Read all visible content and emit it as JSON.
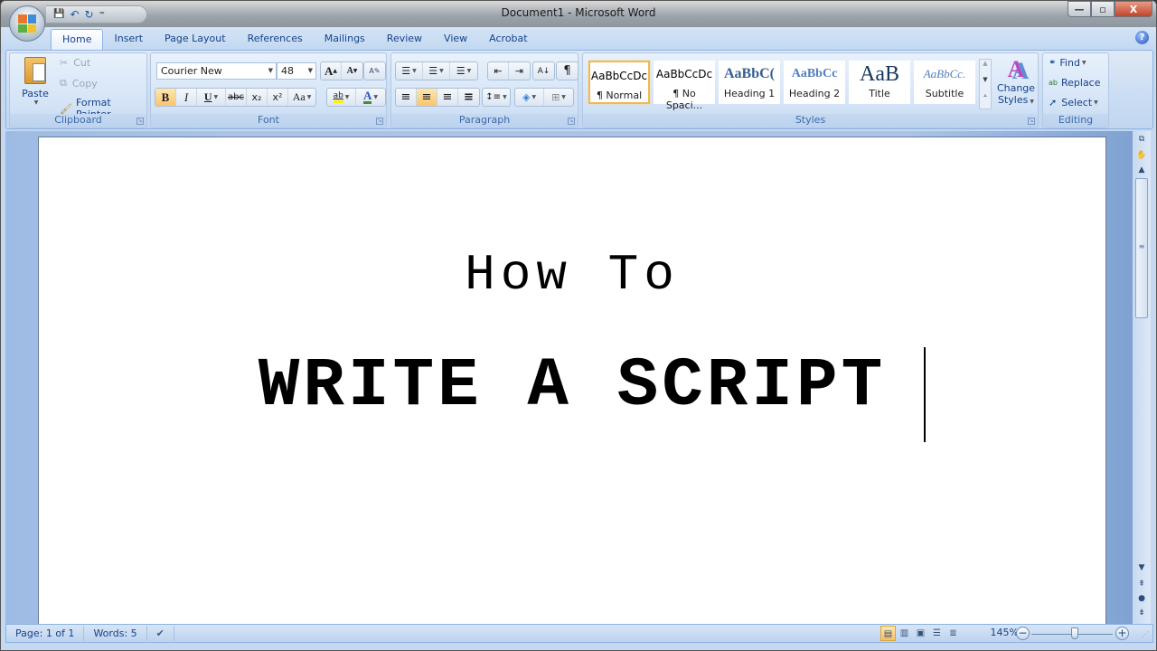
{
  "window": {
    "title": "Document1 - Microsoft Word",
    "controls": {
      "minimize": "—",
      "maximize": "▫",
      "close": "X"
    }
  },
  "quick_access": {
    "save": "💾",
    "undo": "↶",
    "redo": "↻",
    "customize": "⁼"
  },
  "tabs": [
    "Home",
    "Insert",
    "Page Layout",
    "References",
    "Mailings",
    "Review",
    "View",
    "Acrobat"
  ],
  "active_tab": "Home",
  "help": "?",
  "ribbon": {
    "clipboard": {
      "label": "Clipboard",
      "paste": "Paste",
      "cut": "Cut",
      "copy": "Copy",
      "format_painter": "Format Painter"
    },
    "font": {
      "label": "Font",
      "font_name": "Courier New",
      "font_size": "48",
      "grow": "A",
      "shrink": "A",
      "clear": "A✎",
      "bold": "B",
      "italic": "I",
      "underline": "U",
      "strikethrough": "abc",
      "subscript": "x₂",
      "superscript": "x²",
      "change_case": "Aa",
      "highlight": "ab",
      "font_color": "A",
      "bold_active": true
    },
    "paragraph": {
      "label": "Paragraph",
      "bullets": "☰",
      "numbering": "☰",
      "multilevel": "☰",
      "decrease_indent": "⇤",
      "increase_indent": "⇥",
      "sort": "A↓",
      "show_marks": "¶",
      "align_left": "≡",
      "align_center": "≡",
      "align_right": "≡",
      "justify": "≡",
      "line_spacing": "↕≡",
      "shading": "◈",
      "borders": "⊞",
      "active_alignment": "center"
    },
    "styles": {
      "label": "Styles",
      "items": [
        {
          "preview": "AaBbCcDc",
          "name": "¶ Normal",
          "selected": true
        },
        {
          "preview": "AaBbCcDc",
          "name": "¶ No Spaci..."
        },
        {
          "preview": "AaBbC(",
          "name": "Heading 1"
        },
        {
          "preview": "AaBbCc",
          "name": "Heading 2"
        },
        {
          "preview": "AaB",
          "name": "Title"
        },
        {
          "preview": "AaBbCc.",
          "name": "Subtitle"
        }
      ],
      "change_styles": "Change Styles",
      "change_styles_line1": "Change",
      "change_styles_line2": "Styles"
    },
    "editing": {
      "label": "Editing",
      "find": "Find",
      "replace": "Replace",
      "select": "Select"
    }
  },
  "document": {
    "line1": "How To",
    "line2": "WRITE A SCRIPT"
  },
  "status": {
    "page": "Page: 1 of 1",
    "words": "Words: 5",
    "zoom": "145%",
    "zoom_percent": 145
  },
  "colors": {
    "ribbon_text": "#15428b",
    "highlight_active": "#f8c56f"
  }
}
